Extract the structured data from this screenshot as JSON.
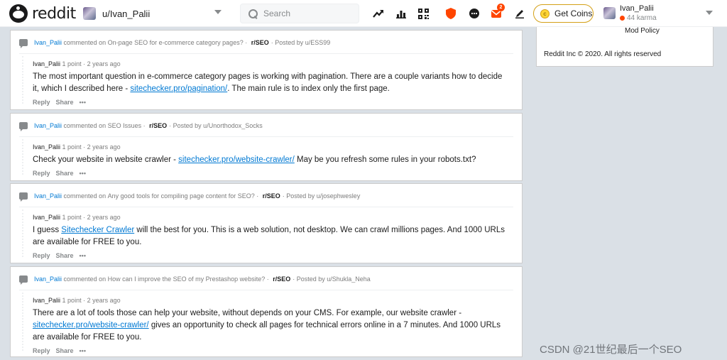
{
  "header": {
    "logo_text": "reddit",
    "user_switcher_label": "u/Ivan_Palii",
    "search_placeholder": "Search",
    "notif_badge": "2",
    "coins_label": "Get Coins",
    "account_name": "Ivan_Palii",
    "account_karma": "44 karma"
  },
  "comments": [
    {
      "ctx_user": "Ivan_Palii",
      "ctx_mid": "commented on",
      "ctx_post": "On-page SEO for e-commerce category pages?",
      "ctx_sub": "r/SEO",
      "ctx_posted_by": "Posted by u/ESS99",
      "author": "Ivan_Palii",
      "points": "1 point",
      "age": "2 years ago",
      "text_before": "The most important question in e-commerce category pages is working with pagination. There are a couple variants how to decide it, which I described here - ",
      "link": "sitechecker.pro/pagination/",
      "text_after": ". The main rule is to index only the first page.",
      "reply": "Reply",
      "share": "Share",
      "more": "•••"
    },
    {
      "ctx_user": "Ivan_Palii",
      "ctx_mid": "commented on",
      "ctx_post": "SEO Issues",
      "ctx_sub": "r/SEO",
      "ctx_posted_by": "Posted by u/Unorthodox_Socks",
      "author": "Ivan_Palii",
      "points": "1 point",
      "age": "2 years ago",
      "text_before": "Check your website in website crawler - ",
      "link": "sitechecker.pro/website-crawler/",
      "text_after": " May be you refresh some rules in your robots.txt?",
      "reply": "Reply",
      "share": "Share",
      "more": "•••"
    },
    {
      "ctx_user": "Ivan_Palii",
      "ctx_mid": "commented on",
      "ctx_post": "Any good tools for compiling page content for SEO?",
      "ctx_sub": "r/SEO",
      "ctx_posted_by": "Posted by u/josephwesley",
      "author": "Ivan_Palii",
      "points": "1 point",
      "age": "2 years ago",
      "text_before": "I guess ",
      "link": "Sitechecker Crawler",
      "text_after": " will the best for you. This is a web solution, not desktop. We can crawl millions pages. And 1000 URLs are available for FREE to you.",
      "reply": "Reply",
      "share": "Share",
      "more": "•••"
    },
    {
      "ctx_user": "Ivan_Palii",
      "ctx_mid": "commented on",
      "ctx_post": "How can I improve the SEO of my Prestashop website?",
      "ctx_sub": "r/SEO",
      "ctx_posted_by": "Posted by u/Shukla_Neha",
      "author": "Ivan_Palii",
      "points": "1 point",
      "age": "2 years ago",
      "text_before": "There are a lot of tools those can help your website, without depends on your CMS. For example, our website crawler - ",
      "link": "sitechecker.pro/website-crawler/",
      "text_after": " gives an opportunity to check all pages for technical errors online in a 7 minutes. And 1000 URLs are available for FREE to you.",
      "reply": "Reply",
      "share": "Share",
      "more": "•••"
    }
  ],
  "sidebar": {
    "mod_policy": "Mod Policy",
    "copyright": "Reddit Inc © 2020. All rights reserved"
  },
  "watermark": "CSDN @21世纪最后一个SEO"
}
